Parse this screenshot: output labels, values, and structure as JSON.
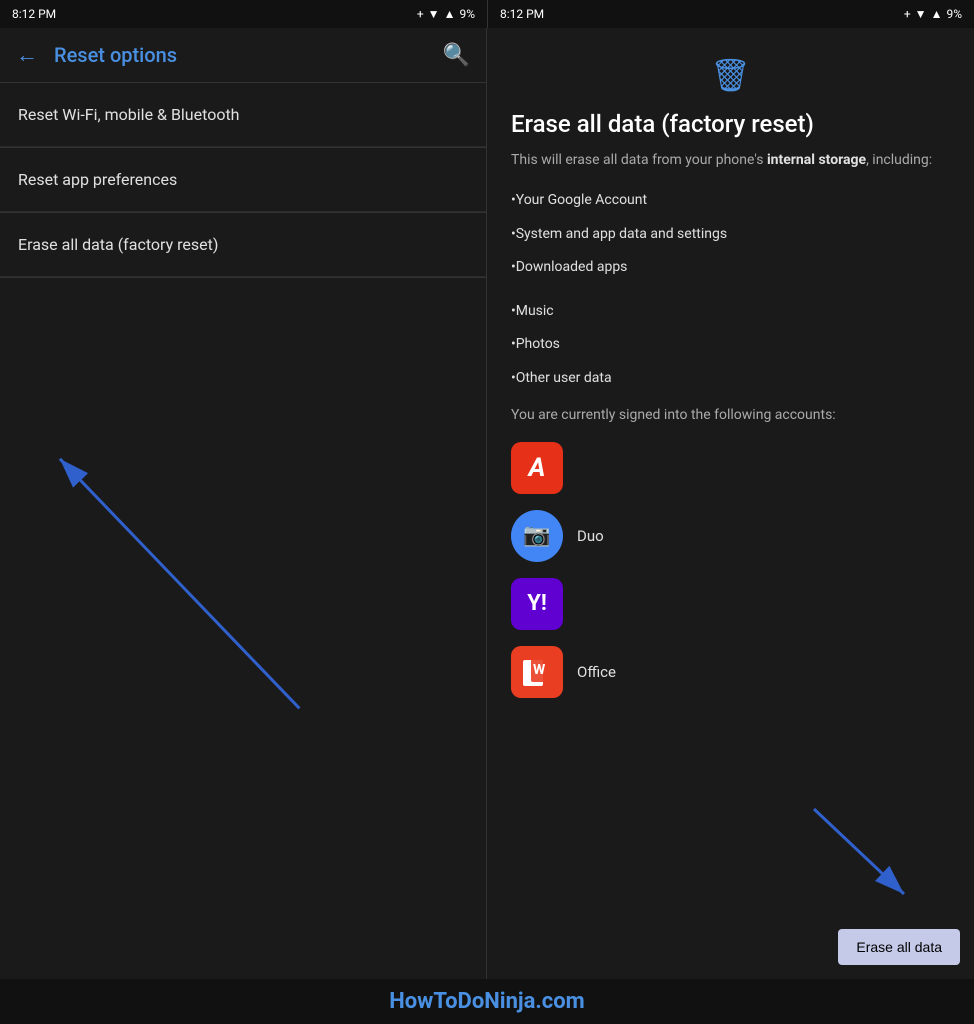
{
  "status_bar": {
    "left": {
      "time": "8:12 PM",
      "battery": "9%"
    },
    "right": {
      "time": "8:12 PM",
      "battery": "9%"
    }
  },
  "left_panel": {
    "header": {
      "back_label": "←",
      "title": "Reset options",
      "search_label": "🔍"
    },
    "menu_items": [
      {
        "label": "Reset Wi-Fi, mobile & Bluetooth"
      },
      {
        "label": "Reset app preferences"
      },
      {
        "label": "Erase all data (factory reset)"
      }
    ]
  },
  "right_panel": {
    "icon": "🗑",
    "title": "Erase all data (factory reset)",
    "description_plain": "This will erase all data from your phone's ",
    "description_bold": "internal storage",
    "description_suffix": ", including:",
    "list_items": [
      "•Your Google Account",
      "•System and app data and settings",
      "•Downloaded apps",
      "•Music",
      "•Photos",
      "•Other user data"
    ],
    "accounts_intro": "You are currently signed into the following accounts:",
    "accounts": [
      {
        "name": "Adobe",
        "type": "adobe",
        "label": ""
      },
      {
        "name": "Duo",
        "type": "duo",
        "label": "Duo"
      },
      {
        "name": "Yahoo",
        "type": "yahoo",
        "label": ""
      },
      {
        "name": "Office",
        "type": "office",
        "label": "Office"
      }
    ],
    "erase_button": "Erase all data"
  },
  "watermark": "HowToDoNinja.com"
}
